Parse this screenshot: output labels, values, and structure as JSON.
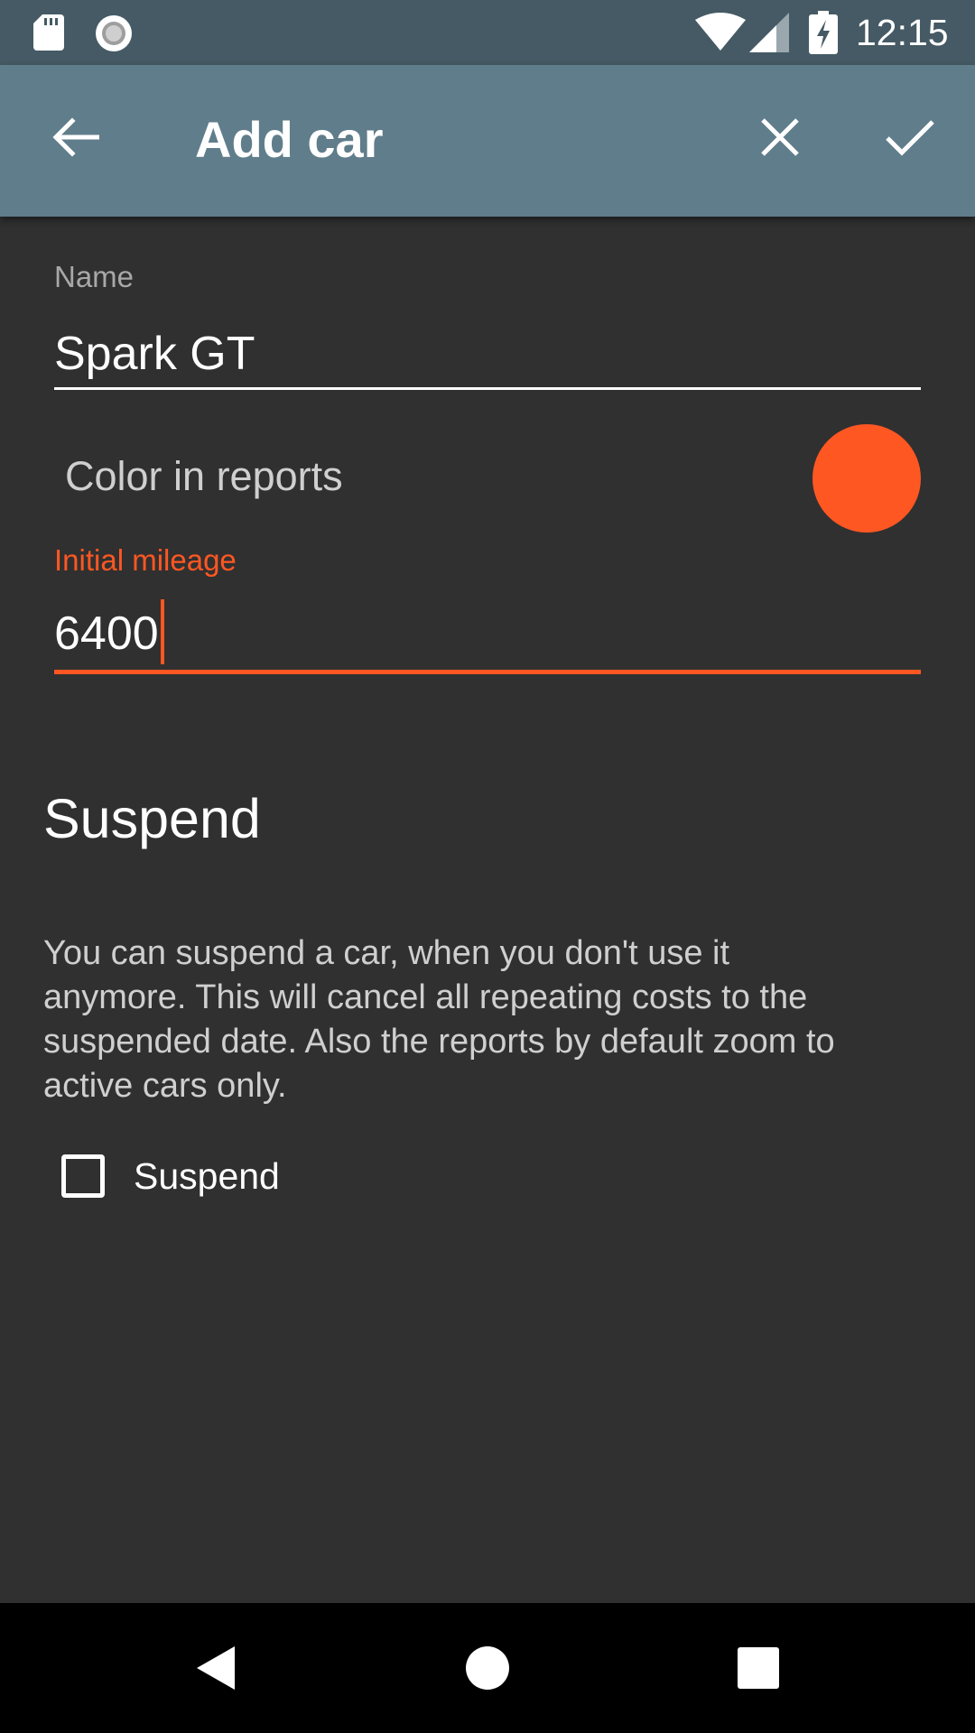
{
  "status_bar": {
    "time": "12:15",
    "icons": [
      "sd-card-icon",
      "radio-icon",
      "wifi-icon",
      "cell-signal-icon",
      "battery-charging-icon"
    ]
  },
  "app_bar": {
    "title": "Add car",
    "back_icon": "arrow-back-icon",
    "close_icon": "close-icon",
    "confirm_icon": "check-icon"
  },
  "form": {
    "name": {
      "label": "Name",
      "value": "Spark GT"
    },
    "color": {
      "label": "Color in reports",
      "value": "#ff5722"
    },
    "initial_mileage": {
      "label": "Initial mileage",
      "value": "6400"
    }
  },
  "suspend_section": {
    "title": "Suspend",
    "description": "You can suspend a car, when you don't use it anymore. This will cancel all repeating costs to the suspended date. Also the reports by default zoom to active cars only.",
    "checkbox_label": "Suspend",
    "checked": false
  },
  "nav_bar": {
    "icons": [
      "nav-back-icon",
      "nav-home-icon",
      "nav-recents-icon"
    ]
  },
  "colors": {
    "accent": "#ff5722",
    "app_bar": "#607d8b",
    "status_bar": "#455a64",
    "background": "#303030"
  }
}
